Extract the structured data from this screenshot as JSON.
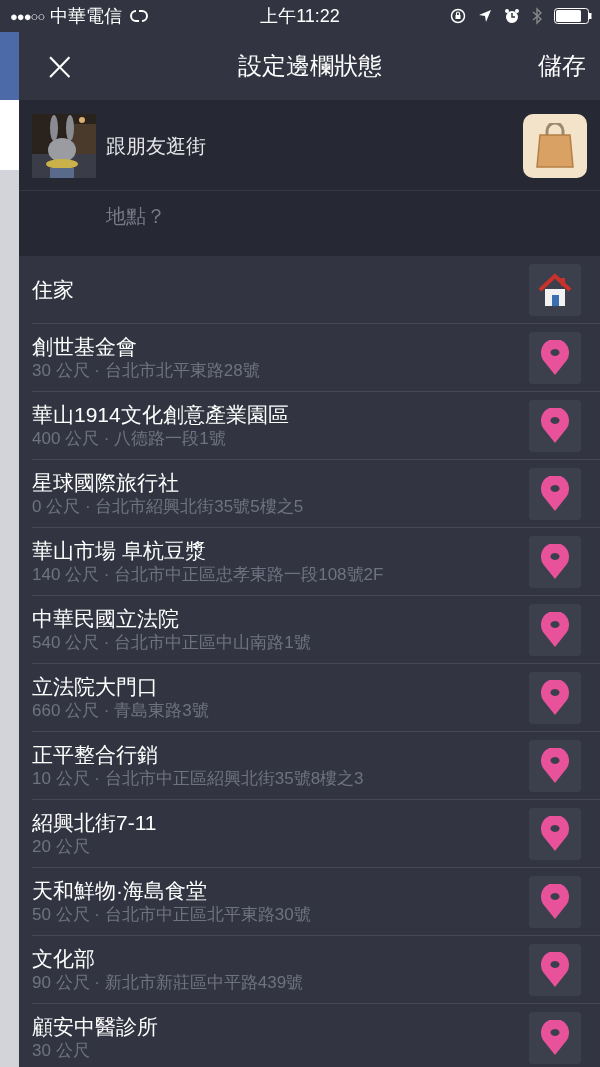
{
  "status_bar": {
    "signal": "●●●○○",
    "carrier": "中華電信",
    "time": "上午11:22"
  },
  "nav": {
    "close": "×",
    "title": "設定邊欄狀態",
    "action": "儲存"
  },
  "composer": {
    "status_text": "跟朋友逛街",
    "location_placeholder": "地點？"
  },
  "places": [
    {
      "kind": "home",
      "name": "住家"
    },
    {
      "kind": "place",
      "name": "創世基金會",
      "detail": "30 公尺 · 台北市北平東路28號"
    },
    {
      "kind": "place",
      "name": "華山1914文化創意產業園區",
      "detail": "400 公尺 · 八德路一段1號"
    },
    {
      "kind": "place",
      "name": "星球國際旅行社",
      "detail": "0 公尺 · 台北市紹興北街35號5樓之5"
    },
    {
      "kind": "place",
      "name": "華山市場 阜杭豆漿",
      "detail": "140 公尺 · 台北市中正區忠孝東路一段108號2F"
    },
    {
      "kind": "place",
      "name": "中華民國立法院",
      "detail": "540 公尺 · 台北市中正區中山南路1號"
    },
    {
      "kind": "place",
      "name": "立法院大門口",
      "detail": "660 公尺 · 青島東路3號"
    },
    {
      "kind": "place",
      "name": "正平整合行銷",
      "detail": "10 公尺 · 台北市中正區紹興北街35號8樓之3"
    },
    {
      "kind": "place",
      "name": "紹興北街7-11",
      "detail": "20 公尺"
    },
    {
      "kind": "place",
      "name": "天和鮮物·海島食堂",
      "detail": "50 公尺 · 台北市中正區北平東路30號"
    },
    {
      "kind": "place",
      "name": "文化部",
      "detail": "90 公尺 · 新北市新莊區中平路439號"
    },
    {
      "kind": "place",
      "name": "顧安中醫診所",
      "detail": "30 公尺"
    }
  ]
}
